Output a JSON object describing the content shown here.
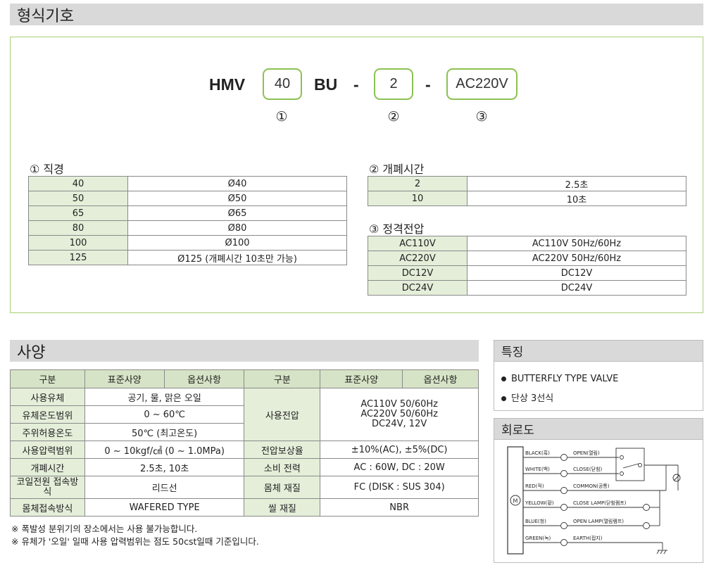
{
  "model_section": {
    "title": "형식기호"
  },
  "model_code": {
    "prefix": "HMV",
    "size": "40",
    "type": "BU",
    "dash1": "-",
    "time": "2",
    "dash2": "-",
    "voltage": "AC220V",
    "marks": [
      "①",
      "②",
      "③"
    ]
  },
  "diameter_table": {
    "title": "① 직경",
    "rows": [
      [
        "40",
        "Ø40"
      ],
      [
        "50",
        "Ø50"
      ],
      [
        "65",
        "Ø65"
      ],
      [
        "80",
        "Ø80"
      ],
      [
        "100",
        "Ø100"
      ],
      [
        "125",
        "Ø125 (개폐시간 10초만 가능)"
      ]
    ]
  },
  "time_table": {
    "title": "② 개폐시간",
    "rows": [
      [
        "2",
        "2.5초"
      ],
      [
        "10",
        "10초"
      ]
    ]
  },
  "voltage_table": {
    "title": "③ 정격전압",
    "rows": [
      [
        "AC110V",
        "AC110V 50Hz/60Hz"
      ],
      [
        "AC220V",
        "AC220V 50Hz/60Hz"
      ],
      [
        "DC12V",
        "DC12V"
      ],
      [
        "DC24V",
        "DC24V"
      ]
    ]
  },
  "spec_section": {
    "title": "사양",
    "headers": [
      "구분",
      "표준사양",
      "옵션사항",
      "구분",
      "표준사양",
      "옵션사항"
    ],
    "left": [
      [
        "사용유체",
        "공기, 물, 맑은 오일"
      ],
      [
        "유체온도범위",
        "0 ~ 60℃"
      ],
      [
        "주위허용온도",
        "50℃ (최고온도)"
      ],
      [
        "사용압력범위",
        "0 ~ 10kgf/㎠ (0 ~ 1.0MPa)"
      ],
      [
        "개폐시간",
        "2.5초, 10초"
      ],
      [
        "코일전원 접속방식",
        "리드선"
      ],
      [
        "몸체접속방식",
        "WAFERED TYPE"
      ]
    ],
    "right": [
      [
        "사용전압",
        "AC110V 50/60Hz\nAC220V 50/60Hz\nDC24V, 12V"
      ],
      [
        "전압보상율",
        "±10%(AC), ±5%(DC)"
      ],
      [
        "소비 전력",
        "AC : 60W, DC : 20W"
      ],
      [
        "몸체 재질",
        "FC (DISK : SUS 304)"
      ],
      [
        "씰 재질",
        "NBR"
      ]
    ],
    "notes": [
      "※ 폭발성 분위기의 장소에서는 사용 불가능합니다.",
      "※ 유체가 '오일' 일때 사용 압력범위는 점도 50cst일때 기준입니다."
    ]
  },
  "features": {
    "title": "특징",
    "items": [
      "BUTTERFLY TYPE VALVE",
      "단상 3선식"
    ]
  },
  "circuit": {
    "title": "회로도",
    "motor": "M",
    "wires": [
      [
        "BLACK(흑)",
        "OPEN(열림)"
      ],
      [
        "WHITE(백)",
        "CLOSE(닫힘)"
      ],
      [
        "RED(적)",
        "COMMON(공통)"
      ],
      [
        "YELLOW(황)",
        "CLOSE LAMP(닫힘램프)"
      ],
      [
        "BLUE(청)",
        "OPEN LAMP(열림램프)"
      ],
      [
        "GREEN(녹)",
        "EARTH(접지)"
      ]
    ]
  },
  "colors": {
    "accent_green": "#8cc152",
    "box_border": "#a9cf74",
    "header_gray": "#d9d9d9",
    "table_green": "#e4eed9"
  }
}
